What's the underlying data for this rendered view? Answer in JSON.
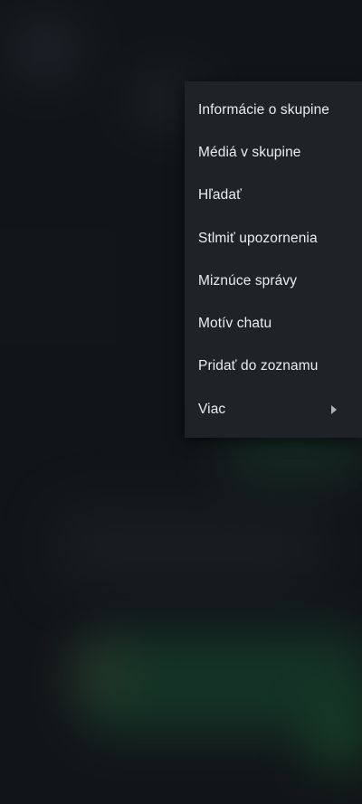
{
  "menu": {
    "items": [
      {
        "label": "Informácie o skupine"
      },
      {
        "label": "Médiá v skupine"
      },
      {
        "label": "Hľadať"
      },
      {
        "label": "Stlmiť upozornenia"
      },
      {
        "label": "Miznúce správy"
      },
      {
        "label": "Motív chatu"
      },
      {
        "label": "Pridať do zoznamu"
      },
      {
        "label": "Viac",
        "submenu_icon": "chevron-right-icon"
      }
    ]
  },
  "colors": {
    "menu_background": "#1f2327",
    "menu_text": "#e9edef",
    "screen_background": "#171b1e"
  }
}
